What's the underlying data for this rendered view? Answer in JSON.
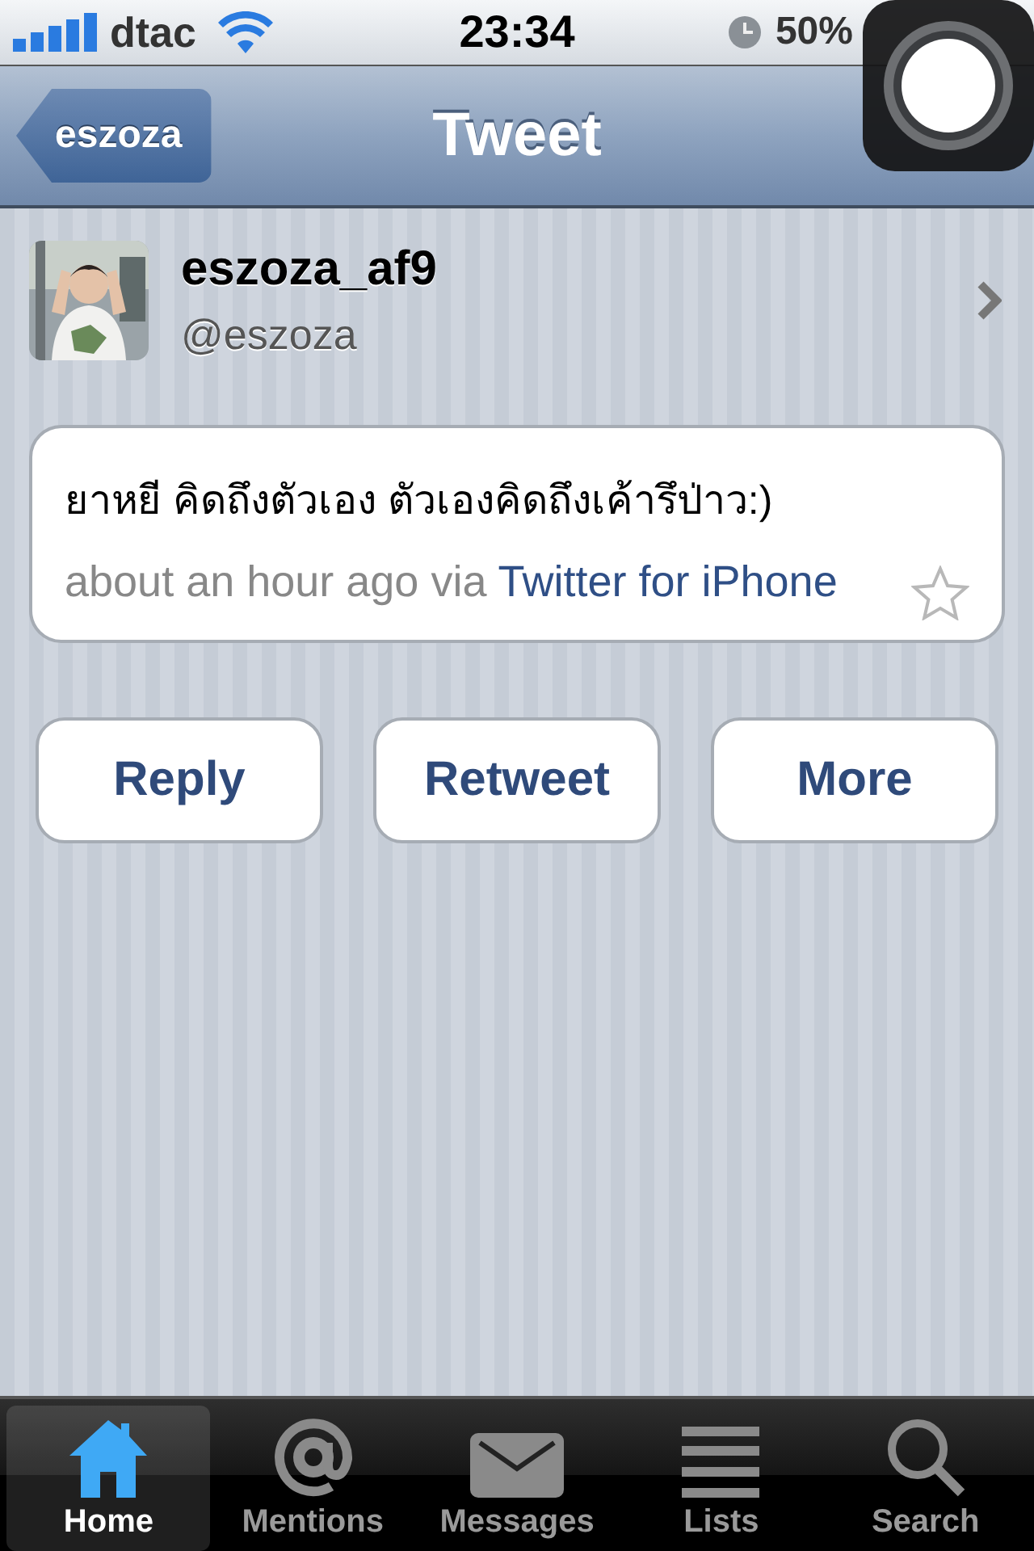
{
  "status_bar": {
    "carrier": "dtac",
    "time": "23:34",
    "battery": "50%"
  },
  "nav_bar": {
    "back": "eszoza",
    "title": "Tweet"
  },
  "profile": {
    "name": "eszoza_af9",
    "handle": "@eszoza"
  },
  "tweet": {
    "text": "ยาหยี คิดถึงตัวเอง ตัวเองคิดถึงเค้ารึป่าว:)",
    "time": "about an hour ago",
    "via": "via",
    "source": "Twitter for iPhone",
    "starred": false
  },
  "actions": [
    "Reply",
    "Retweet",
    "More"
  ],
  "tabs": [
    {
      "label": "Home",
      "kind": "home",
      "selected": true
    },
    {
      "label": "Mentions",
      "kind": "mentions",
      "selected": false
    },
    {
      "label": "Messages",
      "kind": "messages",
      "selected": false
    },
    {
      "label": "Lists",
      "kind": "lists",
      "selected": false
    },
    {
      "label": "Search",
      "kind": "search",
      "selected": false
    }
  ]
}
